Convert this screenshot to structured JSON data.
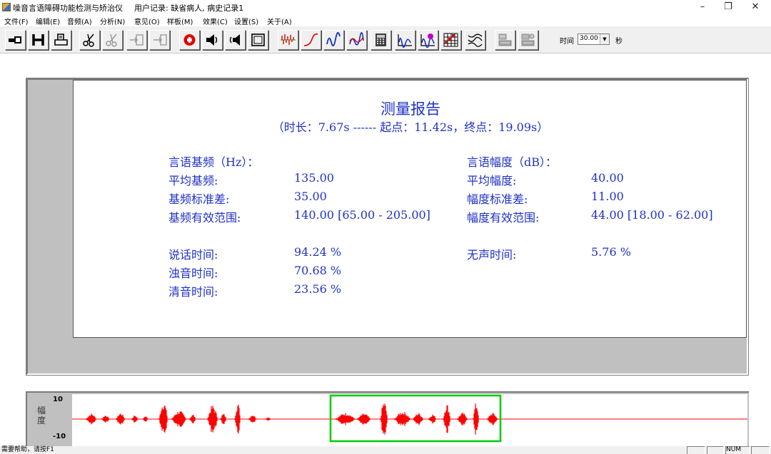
{
  "window": {
    "app_title": "噪音言语障碍功能检测与矫治仪",
    "user_record": "用户记录: 缺省病人, 病史记录1",
    "controls": {
      "minimize": "–",
      "restore": "❐",
      "close": "✕"
    }
  },
  "menu": [
    {
      "id": "file",
      "label": "文件(F)"
    },
    {
      "id": "edit",
      "label": "编辑(E)"
    },
    {
      "id": "audio",
      "label": "音频(A)"
    },
    {
      "id": "analysis",
      "label": "分析(N)"
    },
    {
      "id": "advice",
      "label": "意见(O)"
    },
    {
      "id": "template",
      "label": "样板(M)"
    },
    {
      "id": "effect",
      "label": "效果(C)"
    },
    {
      "id": "settings",
      "label": "设置(S)"
    },
    {
      "id": "about",
      "label": "关于(A)"
    }
  ],
  "toolbar": {
    "buttons": [
      {
        "name": "open-patient",
        "icon": "hand-folder-icon"
      },
      {
        "name": "save",
        "icon": "save-h-icon"
      },
      {
        "name": "print",
        "icon": "printer-icon"
      },
      {
        "name": "cut",
        "icon": "scissors-icon"
      },
      {
        "name": "cut-disabled",
        "icon": "scissors-gray-icon"
      },
      {
        "name": "import",
        "icon": "import-icon"
      },
      {
        "name": "export",
        "icon": "export-icon"
      },
      {
        "name": "record",
        "icon": "record-icon"
      },
      {
        "name": "play",
        "icon": "speaker-icon"
      },
      {
        "name": "play-selection",
        "icon": "speaker-left-icon"
      },
      {
        "name": "frame",
        "icon": "frame-icon"
      },
      {
        "name": "waveform",
        "icon": "waveform-icon"
      },
      {
        "name": "pitch-curve",
        "icon": "rising-curve-icon"
      },
      {
        "name": "pitch-contour",
        "icon": "blue-wave-icon"
      },
      {
        "name": "dual-contour",
        "icon": "dual-wave-icon"
      },
      {
        "name": "calculator",
        "icon": "calculator-icon"
      },
      {
        "name": "spectrum",
        "icon": "spectrum-icon"
      },
      {
        "name": "spectrum-g",
        "icon": "spectrum-g-icon"
      },
      {
        "name": "grid-chart",
        "icon": "grid-chart-icon"
      },
      {
        "name": "multi-wave",
        "icon": "multi-wave-icon"
      },
      {
        "name": "stat-report",
        "icon": "report-gray-icon"
      },
      {
        "name": "stat-export",
        "icon": "report-gray-2-icon"
      }
    ],
    "time_label": "时间",
    "time_value": "30.00",
    "time_unit": "秒"
  },
  "report": {
    "title": "测量报告",
    "subtitle": "（时长：7.67s ------ 起点：11.42s，终点：19.09s）",
    "pitch": {
      "heading": "言语基频（Hz）：",
      "rows": [
        {
          "label": "平均基频:",
          "value": "135.00"
        },
        {
          "label": "基频标准差:",
          "value": "35.00"
        },
        {
          "label": "基频有效范围:",
          "value": "140.00 [65.00 - 205.00]"
        }
      ]
    },
    "amplitude": {
      "heading": "言语幅度（dB）：",
      "rows": [
        {
          "label": "平均幅度:",
          "value": "40.00"
        },
        {
          "label": "幅度标准差:",
          "value": "11.00"
        },
        {
          "label": "幅度有效范围:",
          "value": "44.00 [18.00 - 62.00]"
        }
      ]
    },
    "time": {
      "rows": [
        {
          "label": "说话时间:",
          "value": "94.24 %"
        },
        {
          "label": "浊音时间:",
          "value": "70.68 %"
        },
        {
          "label": "清音时间:",
          "value": "23.56 %"
        }
      ],
      "silence": {
        "label": "无声时间:",
        "value": "5.76 %"
      }
    }
  },
  "waveform": {
    "axis_label": "幅度",
    "y_top": "10",
    "y_bottom": "-10",
    "wave_color": "#ff0000",
    "selection_color": "#00cc00"
  },
  "status": {
    "help": "需要帮助，请按F1",
    "num": "NUM"
  }
}
